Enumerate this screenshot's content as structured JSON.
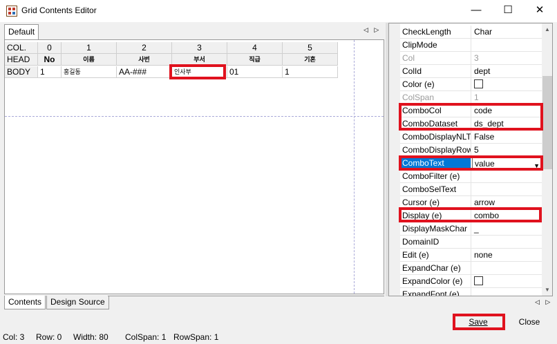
{
  "window": {
    "title": "Grid Contents Editor",
    "minimize_glyph": "—",
    "maximize_glyph": "☐",
    "close_glyph": "✕"
  },
  "top_tabs": [
    {
      "label": "Default"
    }
  ],
  "nav_arrows": "◁ ▷",
  "grid": {
    "col_row_label": "COL.",
    "head_row_label": "HEAD",
    "body_row_label": "BODY",
    "columns": [
      "0",
      "1",
      "2",
      "3",
      "4",
      "5"
    ],
    "head": [
      "No",
      "이름",
      "사번",
      "부서",
      "직급",
      "기혼"
    ],
    "body": [
      "1",
      "홍길동",
      "AA-###",
      "인사부",
      "01",
      "1"
    ]
  },
  "properties": [
    {
      "name": "CheckLength",
      "value": "Char",
      "disabled": false
    },
    {
      "name": "ClipMode",
      "value": "",
      "disabled": false
    },
    {
      "name": "Col",
      "value": "3",
      "disabled": true
    },
    {
      "name": "ColId",
      "value": "dept",
      "disabled": false
    },
    {
      "name": "Color (e)",
      "value": "",
      "checkbox": true,
      "disabled": false
    },
    {
      "name": "ColSpan",
      "value": "1",
      "disabled": true
    },
    {
      "name": "ComboCol",
      "value": "code",
      "disabled": false
    },
    {
      "name": "ComboDataset",
      "value": "ds_dept",
      "disabled": false
    },
    {
      "name": "ComboDisplayNLT",
      "value": "False",
      "disabled": false
    },
    {
      "name": "ComboDisplayRow",
      "value": "5",
      "disabled": false
    },
    {
      "name": "ComboText",
      "value": "value",
      "selected": true,
      "disabled": false
    },
    {
      "name": "ComboFilter (e)",
      "value": "",
      "disabled": false
    },
    {
      "name": "ComboSelText",
      "value": "",
      "disabled": false
    },
    {
      "name": "Cursor (e)",
      "value": "arrow",
      "disabled": false
    },
    {
      "name": "Display (e)",
      "value": "combo",
      "disabled": false
    },
    {
      "name": "DisplayMaskChar",
      "value": "_",
      "disabled": false
    },
    {
      "name": "DomainID",
      "value": "",
      "disabled": false
    },
    {
      "name": "Edit (e)",
      "value": "none",
      "disabled": false
    },
    {
      "name": "ExpandChar (e)",
      "value": "",
      "disabled": false
    },
    {
      "name": "ExpandColor (e)",
      "value": "",
      "checkbox": true,
      "disabled": false
    },
    {
      "name": "ExpandFont (e)",
      "value": "",
      "disabled": false
    }
  ],
  "bottom_tabs": [
    {
      "label": "Contents",
      "active": true
    },
    {
      "label": "Design Source",
      "active": false
    }
  ],
  "buttons": {
    "save": "Save",
    "close": "Close"
  },
  "status": {
    "col": "Col: 3",
    "row": "Row: 0",
    "width": "Width: 80",
    "colspan": "ColSpan: 1",
    "rowspan": "RowSpan: 1"
  },
  "colors": {
    "highlight": "#e0121e",
    "selection": "#0078d7"
  }
}
